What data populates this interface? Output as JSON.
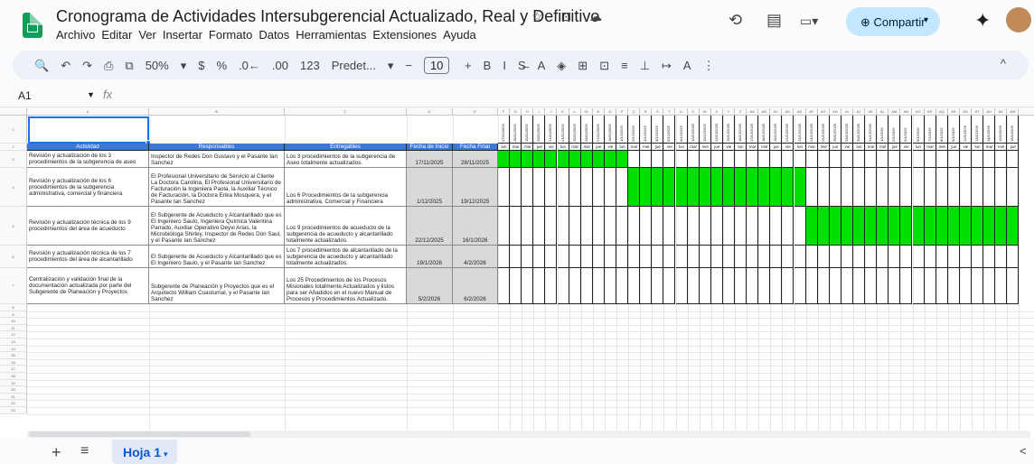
{
  "app": {
    "title": "Cronograma de Actividades Intersubgerencial Actualizado, Real y Definitivo",
    "title_icons": "☆ ⊡ ☁",
    "menu": [
      "Archivo",
      "Editar",
      "Ver",
      "Insertar",
      "Formato",
      "Datos",
      "Herramientas",
      "Extensiones",
      "Ayuda"
    ],
    "share_label": "Compartir",
    "history_icon": "⟲",
    "comments_icon": "▤",
    "meet_icon": "▭▾",
    "gemini_icon": "✦"
  },
  "toolbar": {
    "items": [
      "🔍",
      "↶",
      "↷",
      "⎙",
      "⧉",
      "50%",
      "▾",
      "$",
      "%",
      ".0←",
      ".00",
      "123",
      "Predet...",
      "▾",
      "−"
    ],
    "font_size": "10",
    "items_after": [
      "+",
      "B",
      "I",
      "S̶",
      "A",
      "◈",
      "⊞",
      "⊡",
      "≡",
      "⊥",
      "↦",
      "A",
      "⋮"
    ],
    "collapse": "^"
  },
  "formula_bar": {
    "cell_ref": "A1",
    "fx": "fx"
  },
  "sheet": {
    "col_letters": [
      "A",
      "B",
      "C",
      "D",
      "E"
    ],
    "headers": [
      "Actividad",
      "Responsables",
      "Entregables",
      "Fecha de Inicio",
      "Fecha Final"
    ],
    "rows": [
      {
        "actividad": "Revisión y actualización de los 3 procedimientos de la subgerencia de aseo",
        "responsables": "Inspector de Redes Don Gustavo y el Pasante Ian Sanchez",
        "entregables": "Los 3 procedimientos de la subgerencia de Aseo totalmente actualizados.",
        "inicio": "17/11/2025",
        "final": "28/11/2025",
        "green_start": 0,
        "green_end": 10
      },
      {
        "actividad": "Revisión y actualización de los 6 procedimientos de la subgerencia administrativa, comercial y financiera",
        "responsables": "El Profesional Universitario de Servicio al Cliente La Doctora Carolina, El Profesional Universitario de Facturación la Ingeniera Paola, la Auxiliar Técnico de Facturación, la Doctora Erika Mosquera, y el Pasante Ian Sanchez",
        "entregables": "Los 6 Procedimientos de la subgerencia administrativa, Comercial y Financiera",
        "inicio": "1/12/2025",
        "final": "19/12/2025",
        "green_start": 11,
        "green_end": 25
      },
      {
        "actividad": "Revisión y actualización técnica de los 9 procedimientos del área de acueducto",
        "responsables": "El Subgerente de Acueducto y Alcantarillado que es El Ingeniero Saulo, Ingeniera Química Valentina Parrado, Auxiliar Operativo Deyvi Arias, la Microbióloga Shirley, Inspector de Redes Don Saul, y el Pasante Ian Sanchez",
        "entregables": "Los 9 procedimientos de acueducto de la subgerencia de acueducto y alcantarillado totalmente actualizados.",
        "inicio": "22/12/2025",
        "final": "16/1/2026",
        "green_start": 26,
        "green_end": 45
      },
      {
        "actividad": "Revisión y actualización técnica de los 7 procedimientos del área de alcantarillado",
        "responsables": "El Subgerente de Acueducto y Alcantarillado que es El Ingeniero Saulo, y el Pasante Ian Sanchez",
        "entregables": "Los 7 procedimientos de alcantarillado de la subgerencia de acueducto y alcantarillado totalmente actualizados.",
        "inicio": "19/1/2026",
        "final": "4/2/2026",
        "green_start": -1,
        "green_end": -1
      },
      {
        "actividad": "Centralización y validación final de la documentación actualizada por parte del Subgerente de Planeación y Proyectos",
        "responsables": "Subgerente de Planeación y Proyectos que es el Arquitecto William Cuasturnal, y el Pasante Ian Sanchez",
        "entregables": "Los 25 Procedimientos de los Procesos Misionales totalmente Actualizados y listos para ser Añadidos en el nuevo Manual de Procesos y Procedimientos Actualizado.",
        "inicio": "5/2/2026",
        "final": "6/2/2026",
        "green_start": -1,
        "green_end": -1
      }
    ],
    "gantt_cols": [
      "F",
      "G",
      "H",
      "I",
      "J",
      "K",
      "L",
      "M",
      "N",
      "O",
      "P",
      "Q",
      "R",
      "S",
      "T",
      "U",
      "V",
      "W",
      "X",
      "Y",
      "Z",
      "AA",
      "AB",
      "AC",
      "AD",
      "AE",
      "AF",
      "AG",
      "AH",
      "AI",
      "AJ",
      "AK",
      "AL",
      "AM",
      "AN",
      "AO",
      "AP",
      "AQ",
      "AR",
      "AS",
      "AT",
      "AU",
      "AV",
      "AW"
    ],
    "gantt_dates": [
      "17/11/2025",
      "18/11/2025",
      "19/11/2025",
      "20/11/2025",
      "21/11/2025",
      "24/11/2025",
      "25/11/2025",
      "26/11/2025",
      "27/11/2025",
      "28/11/2025",
      "1/12/2025",
      "2/12/2025",
      "3/12/2025",
      "4/12/2025",
      "5/12/2025",
      "9/12/2025",
      "10/12/2025",
      "11/12/2025",
      "12/12/2025",
      "15/12/2025",
      "16/12/2025",
      "17/12/2025",
      "18/12/2025",
      "19/12/2025",
      "22/12/2025",
      "23/12/2025",
      "24/12/2025",
      "25/12/2025",
      "26/12/2025",
      "29/12/2025",
      "30/12/2025",
      "31/12/2025",
      "1/1/2026",
      "2/1/2026",
      "5/1/2026",
      "6/1/2026",
      "7/1/2026",
      "8/1/2026",
      "9/1/2026",
      "12/1/2026",
      "13/1/2026",
      "14/1/2026",
      "15/1/2026",
      "16/1/2026"
    ],
    "gantt_days": [
      "lun",
      "mar",
      "mié",
      "jue",
      "vie",
      "lun",
      "mar",
      "mié",
      "jue",
      "vie",
      "lun",
      "mar",
      "mié",
      "jue",
      "vie",
      "lun",
      "mar",
      "mié",
      "jue",
      "vie",
      "lun",
      "mar",
      "mié",
      "jue",
      "vie",
      "lun",
      "mar",
      "mié",
      "jue",
      "vie",
      "lun",
      "mar",
      "mié",
      "jue",
      "vie",
      "lun",
      "mar",
      "mié",
      "jue",
      "vie",
      "lun",
      "mar",
      "mié",
      "jue"
    ],
    "row_numbers": [
      "1",
      "2",
      "3",
      "4",
      "5",
      "6",
      "7",
      "8",
      "9",
      "10",
      "11",
      "12",
      "13",
      "14",
      "15",
      "16",
      "17",
      "18",
      "19",
      "20",
      "21",
      "22",
      "23"
    ]
  },
  "bottom": {
    "add": "+",
    "list": "≡",
    "sheet_tab": "Hoja 1",
    "tab_arrow": "▾",
    "nav": "<"
  },
  "colors": {
    "header_blue": "#3c78d8",
    "gantt_green": "#00e000",
    "share_bg": "#c2e7ff",
    "accent": "#1a73e8"
  }
}
